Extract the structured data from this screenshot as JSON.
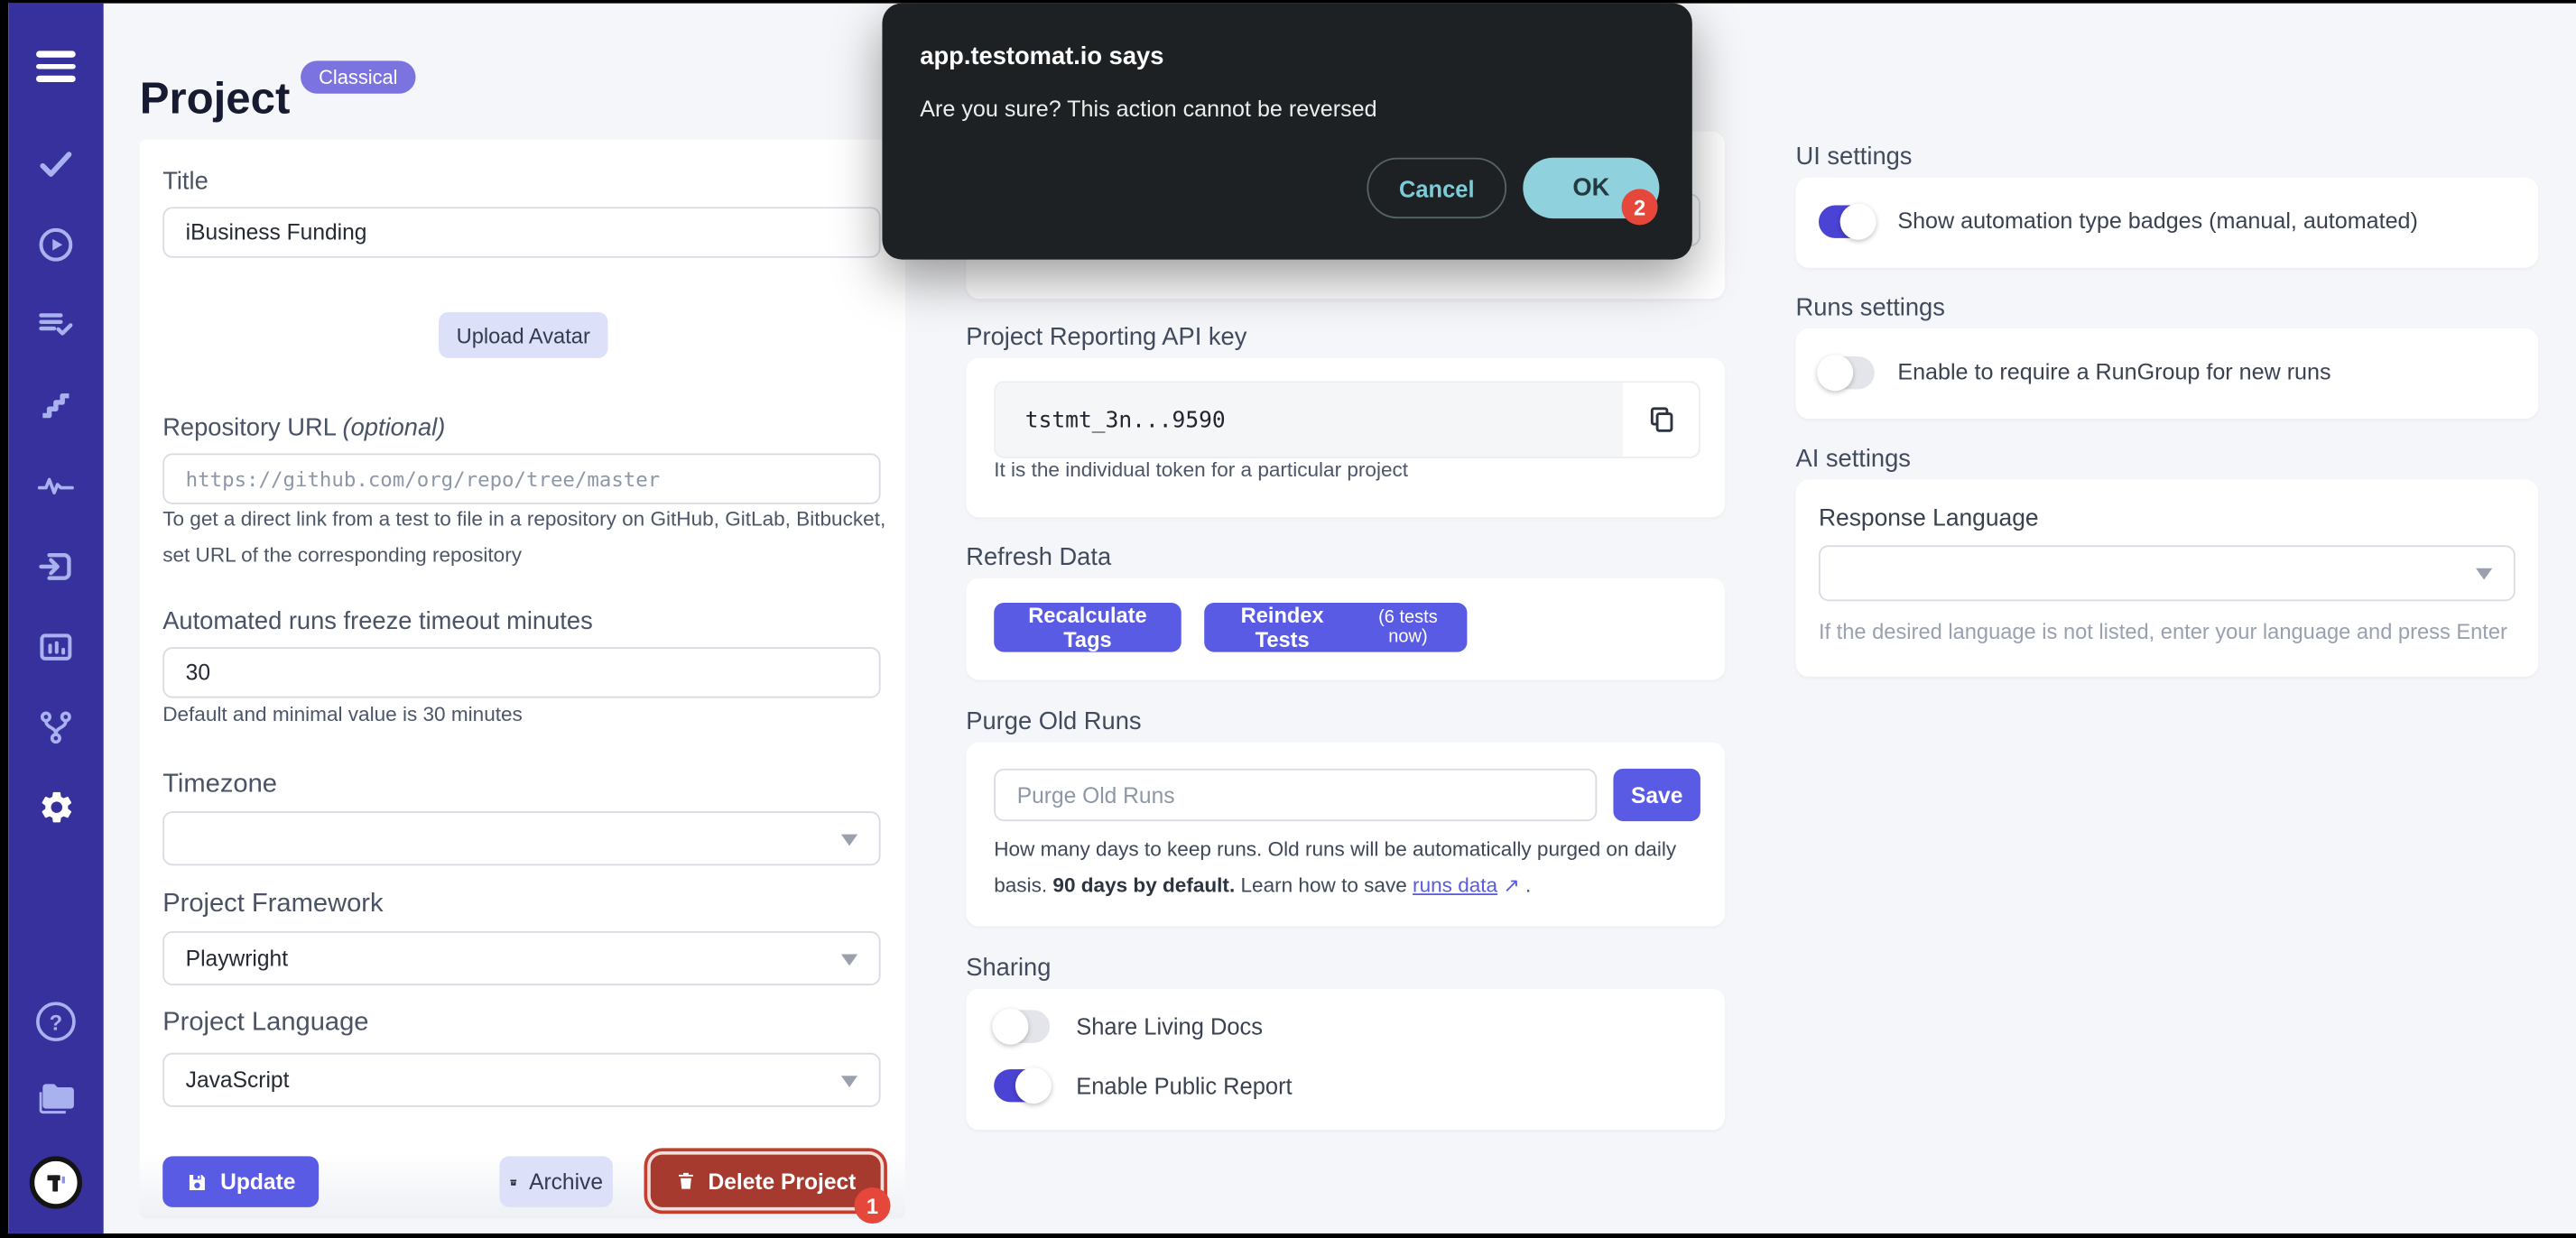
{
  "colors": {
    "sidebar": "#37319e",
    "accent": "#5a5be4",
    "danger": "#a63a2e",
    "ok": "#8fd1dd",
    "badge": "#e5473b",
    "toggle_on": "#4a43d4"
  },
  "dialog": {
    "title": "app.testomat.io says",
    "message": "Are you sure? This action cannot be reversed",
    "cancel_label": "Cancel",
    "ok_label": "OK",
    "ok_annotation": "2"
  },
  "header": {
    "title": "Project",
    "badge": "Classical"
  },
  "sidebar": {
    "items": [
      "menu",
      "tests-check",
      "runs-play",
      "results-list-check",
      "steps-stairs",
      "pulse-analytics",
      "sign-in",
      "bar-chart",
      "git-branch",
      "settings-gear",
      "help",
      "projects-folder",
      "testomat-logo"
    ],
    "help_glyph": "?"
  },
  "left_form": {
    "title_label": "Title",
    "title_value": "iBusiness Funding",
    "upload_avatar_label": "Upload Avatar",
    "repo_label": "Repository URL",
    "repo_optional": "(optional)",
    "repo_placeholder": "https://github.com/org/repo/tree/master",
    "repo_help": "To get a direct link from a test to file in a repository on GitHub, GitLab, Bitbucket, set URL of the corresponding repository",
    "freeze_label": "Automated runs freeze timeout minutes",
    "freeze_value": "30",
    "freeze_help": "Default and minimal value is 30 minutes",
    "timezone_label": "Timezone",
    "timezone_value": "",
    "framework_label": "Project Framework",
    "framework_value": "Playwright",
    "language_label": "Project Language",
    "language_value": "JavaScript",
    "update_label": "Update",
    "archive_label": "Archive",
    "delete_label": "Delete Project",
    "delete_annotation": "1"
  },
  "middle": {
    "api_key_label": "Project Reporting API key",
    "api_key_value": "tstmt_3n...9590",
    "api_key_help": "It is the individual token for a particular project",
    "refresh_label": "Refresh Data",
    "recalculate_label": "Recalculate Tags",
    "reindex_label": "Reindex Tests",
    "reindex_note": "(6 tests now)",
    "purge_label": "Purge Old Runs",
    "purge_placeholder": "Purge Old Runs",
    "save_label": "Save",
    "purge_help_normal": "How many days to keep runs. Old runs will be automatically purged on daily basis. ",
    "purge_help_bold": "90 days by default.",
    "purge_help_learn": " Learn how to save ",
    "purge_link": "runs data",
    "purge_link_arrow": "↗",
    "purge_help_end": " .",
    "sharing_label": "Sharing",
    "share_living_docs_label": "Share Living Docs",
    "enable_public_report_label": "Enable Public Report"
  },
  "right": {
    "ui_settings_label": "UI settings",
    "show_badges_label": "Show automation type badges (manual, automated)",
    "runs_settings_label": "Runs settings",
    "rungroup_label": "Enable to require a RunGroup for new runs",
    "ai_settings_label": "AI settings",
    "response_language_label": "Response Language",
    "response_language_value": "",
    "response_language_help": "If the desired language is not listed, enter your language and press Enter"
  },
  "toggles": {
    "share_living_docs": false,
    "enable_public_report": true,
    "show_badges": true,
    "rungroup": false
  }
}
